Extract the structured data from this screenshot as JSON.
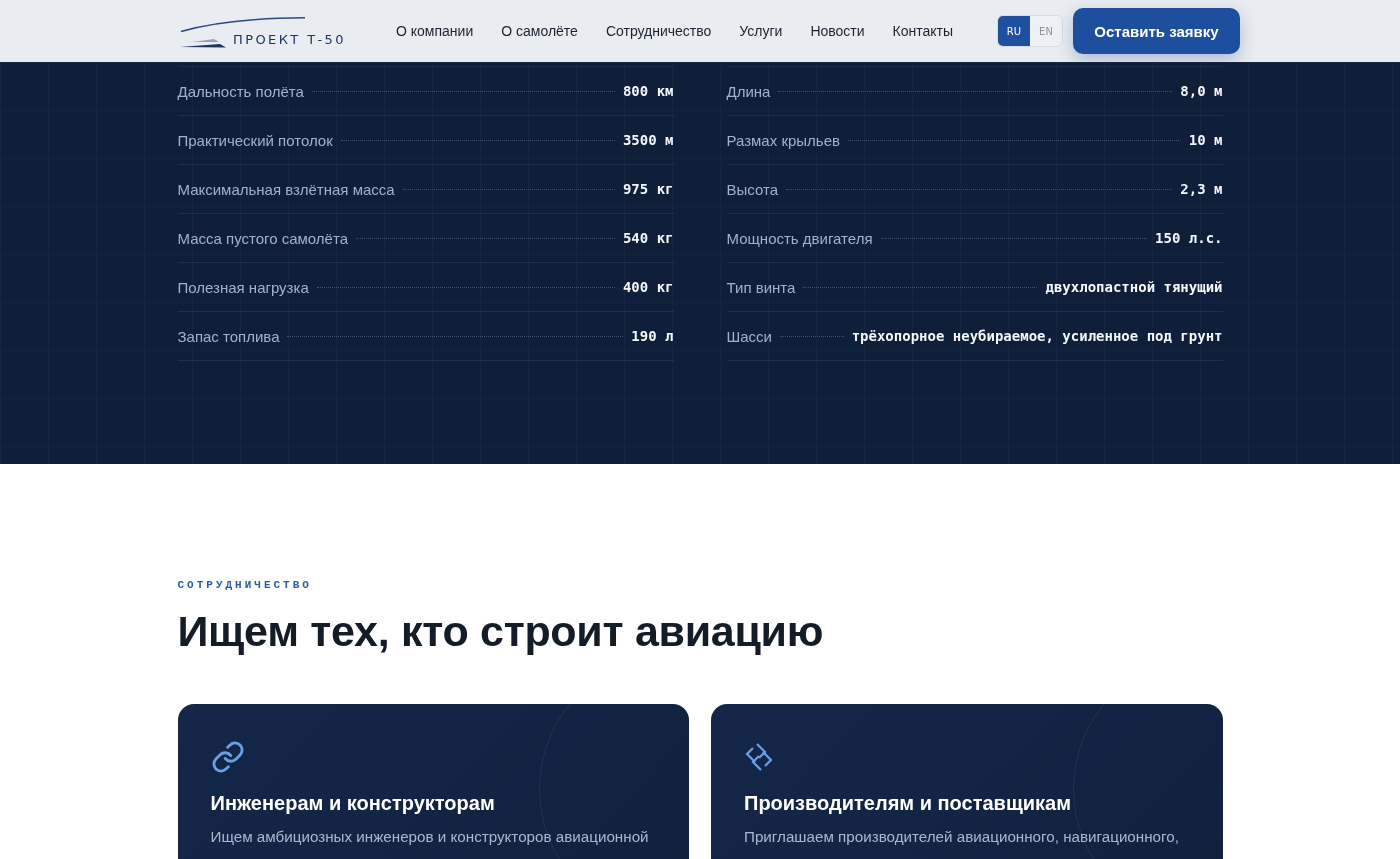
{
  "header": {
    "logo_text": "ПРОЕКТ Т-50",
    "nav": [
      "О компании",
      "О самолёте",
      "Сотрудничество",
      "Услуги",
      "Новости",
      "Контакты"
    ],
    "languages": [
      {
        "label": "RU",
        "selected": true
      },
      {
        "label": "EN",
        "selected": false
      }
    ],
    "cta_button": "Оставить заявку"
  },
  "specs": {
    "columns": [
      [
        {
          "label": "Дальность полёта",
          "value": "800 км"
        },
        {
          "label": "Практический потолок",
          "value": "3500 м"
        },
        {
          "label": "Максимальная взлётная масса",
          "value": "975 кг"
        },
        {
          "label": "Масса пустого самолёта",
          "value": "540 кг"
        },
        {
          "label": "Полезная нагрузка",
          "value": "400 кг"
        },
        {
          "label": "Запас топлива",
          "value": "190 л"
        }
      ],
      [
        {
          "label": "Длина",
          "value": "8,0 м"
        },
        {
          "label": "Размах крыльев",
          "value": "10 м"
        },
        {
          "label": "Высота",
          "value": "2,3 м"
        },
        {
          "label": "Мощность двигателя",
          "value": "150 л.с."
        },
        {
          "label": "Тип винта",
          "value": "двухлопастной тянущий"
        },
        {
          "label": "Шасси",
          "value": "трёхопорное неубираемое, усиленное под грунт"
        }
      ]
    ]
  },
  "cooperation": {
    "eyebrow": "СОТРУДНИЧЕСТВО",
    "heading": "Ищем тех, кто строит авиацию",
    "cards": [
      {
        "kind": "link",
        "title": "Инженерам и конструкторам",
        "description": "Ищем амбициозных инженеров и конструкторов авиационной"
      },
      {
        "kind": "squares",
        "title": "Производителям и поставщикам",
        "description": "Приглашаем производителей авиационного, навигационного,"
      }
    ]
  }
}
